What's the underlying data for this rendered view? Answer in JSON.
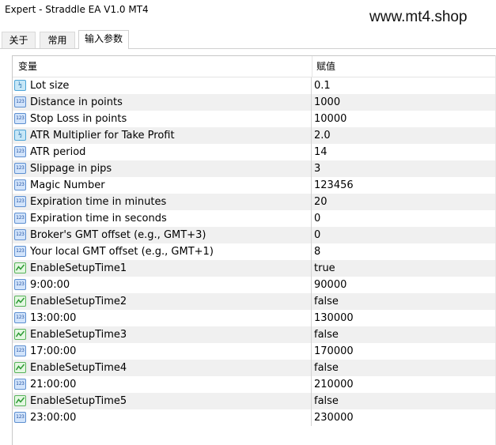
{
  "window": {
    "title": "Expert - Straddle EA V1.0 MT4"
  },
  "watermark": "www.mt4.shop",
  "tabs": [
    {
      "label": "关于",
      "active": false
    },
    {
      "label": "常用",
      "active": false
    },
    {
      "label": "输入参数",
      "active": true
    }
  ],
  "table": {
    "columns": {
      "name": "变量",
      "value": "赋值"
    },
    "rows": [
      {
        "icon": "double-type-icon",
        "name": "Lot size",
        "value": "0.1"
      },
      {
        "icon": "integer-type-icon",
        "name": "Distance in points",
        "value": "1000"
      },
      {
        "icon": "integer-type-icon",
        "name": "Stop Loss in points",
        "value": "10000"
      },
      {
        "icon": "double-type-icon",
        "name": "ATR Multiplier for Take Profit",
        "value": "2.0"
      },
      {
        "icon": "integer-type-icon",
        "name": "ATR period",
        "value": "14"
      },
      {
        "icon": "integer-type-icon",
        "name": "Slippage in pips",
        "value": "3"
      },
      {
        "icon": "integer-type-icon",
        "name": "Magic Number",
        "value": "123456"
      },
      {
        "icon": "integer-type-icon",
        "name": "Expiration time in minutes",
        "value": "20"
      },
      {
        "icon": "integer-type-icon",
        "name": "Expiration time in seconds",
        "value": "0"
      },
      {
        "icon": "integer-type-icon",
        "name": "Broker's GMT offset (e.g., GMT+3)",
        "value": "0"
      },
      {
        "icon": "integer-type-icon",
        "name": "Your local GMT offset (e.g., GMT+1)",
        "value": "8"
      },
      {
        "icon": "boolean-type-icon",
        "name": "EnableSetupTime1",
        "value": "true"
      },
      {
        "icon": "integer-type-icon",
        "name": "9:00:00",
        "value": "90000"
      },
      {
        "icon": "boolean-type-icon",
        "name": "EnableSetupTime2",
        "value": "false"
      },
      {
        "icon": "integer-type-icon",
        "name": "13:00:00",
        "value": "130000"
      },
      {
        "icon": "boolean-type-icon",
        "name": "EnableSetupTime3",
        "value": "false"
      },
      {
        "icon": "integer-type-icon",
        "name": "17:00:00",
        "value": "170000"
      },
      {
        "icon": "boolean-type-icon",
        "name": "EnableSetupTime4",
        "value": "false"
      },
      {
        "icon": "integer-type-icon",
        "name": "21:00:00",
        "value": "210000"
      },
      {
        "icon": "boolean-type-icon",
        "name": "EnableSetupTime5",
        "value": "false"
      },
      {
        "icon": "integer-type-icon",
        "name": "23:00:00",
        "value": "230000"
      }
    ]
  },
  "colors": {
    "row_shade": "#f0f0f0",
    "bool_icon": "#58b35a",
    "int_icon": "#5d8fd0"
  }
}
